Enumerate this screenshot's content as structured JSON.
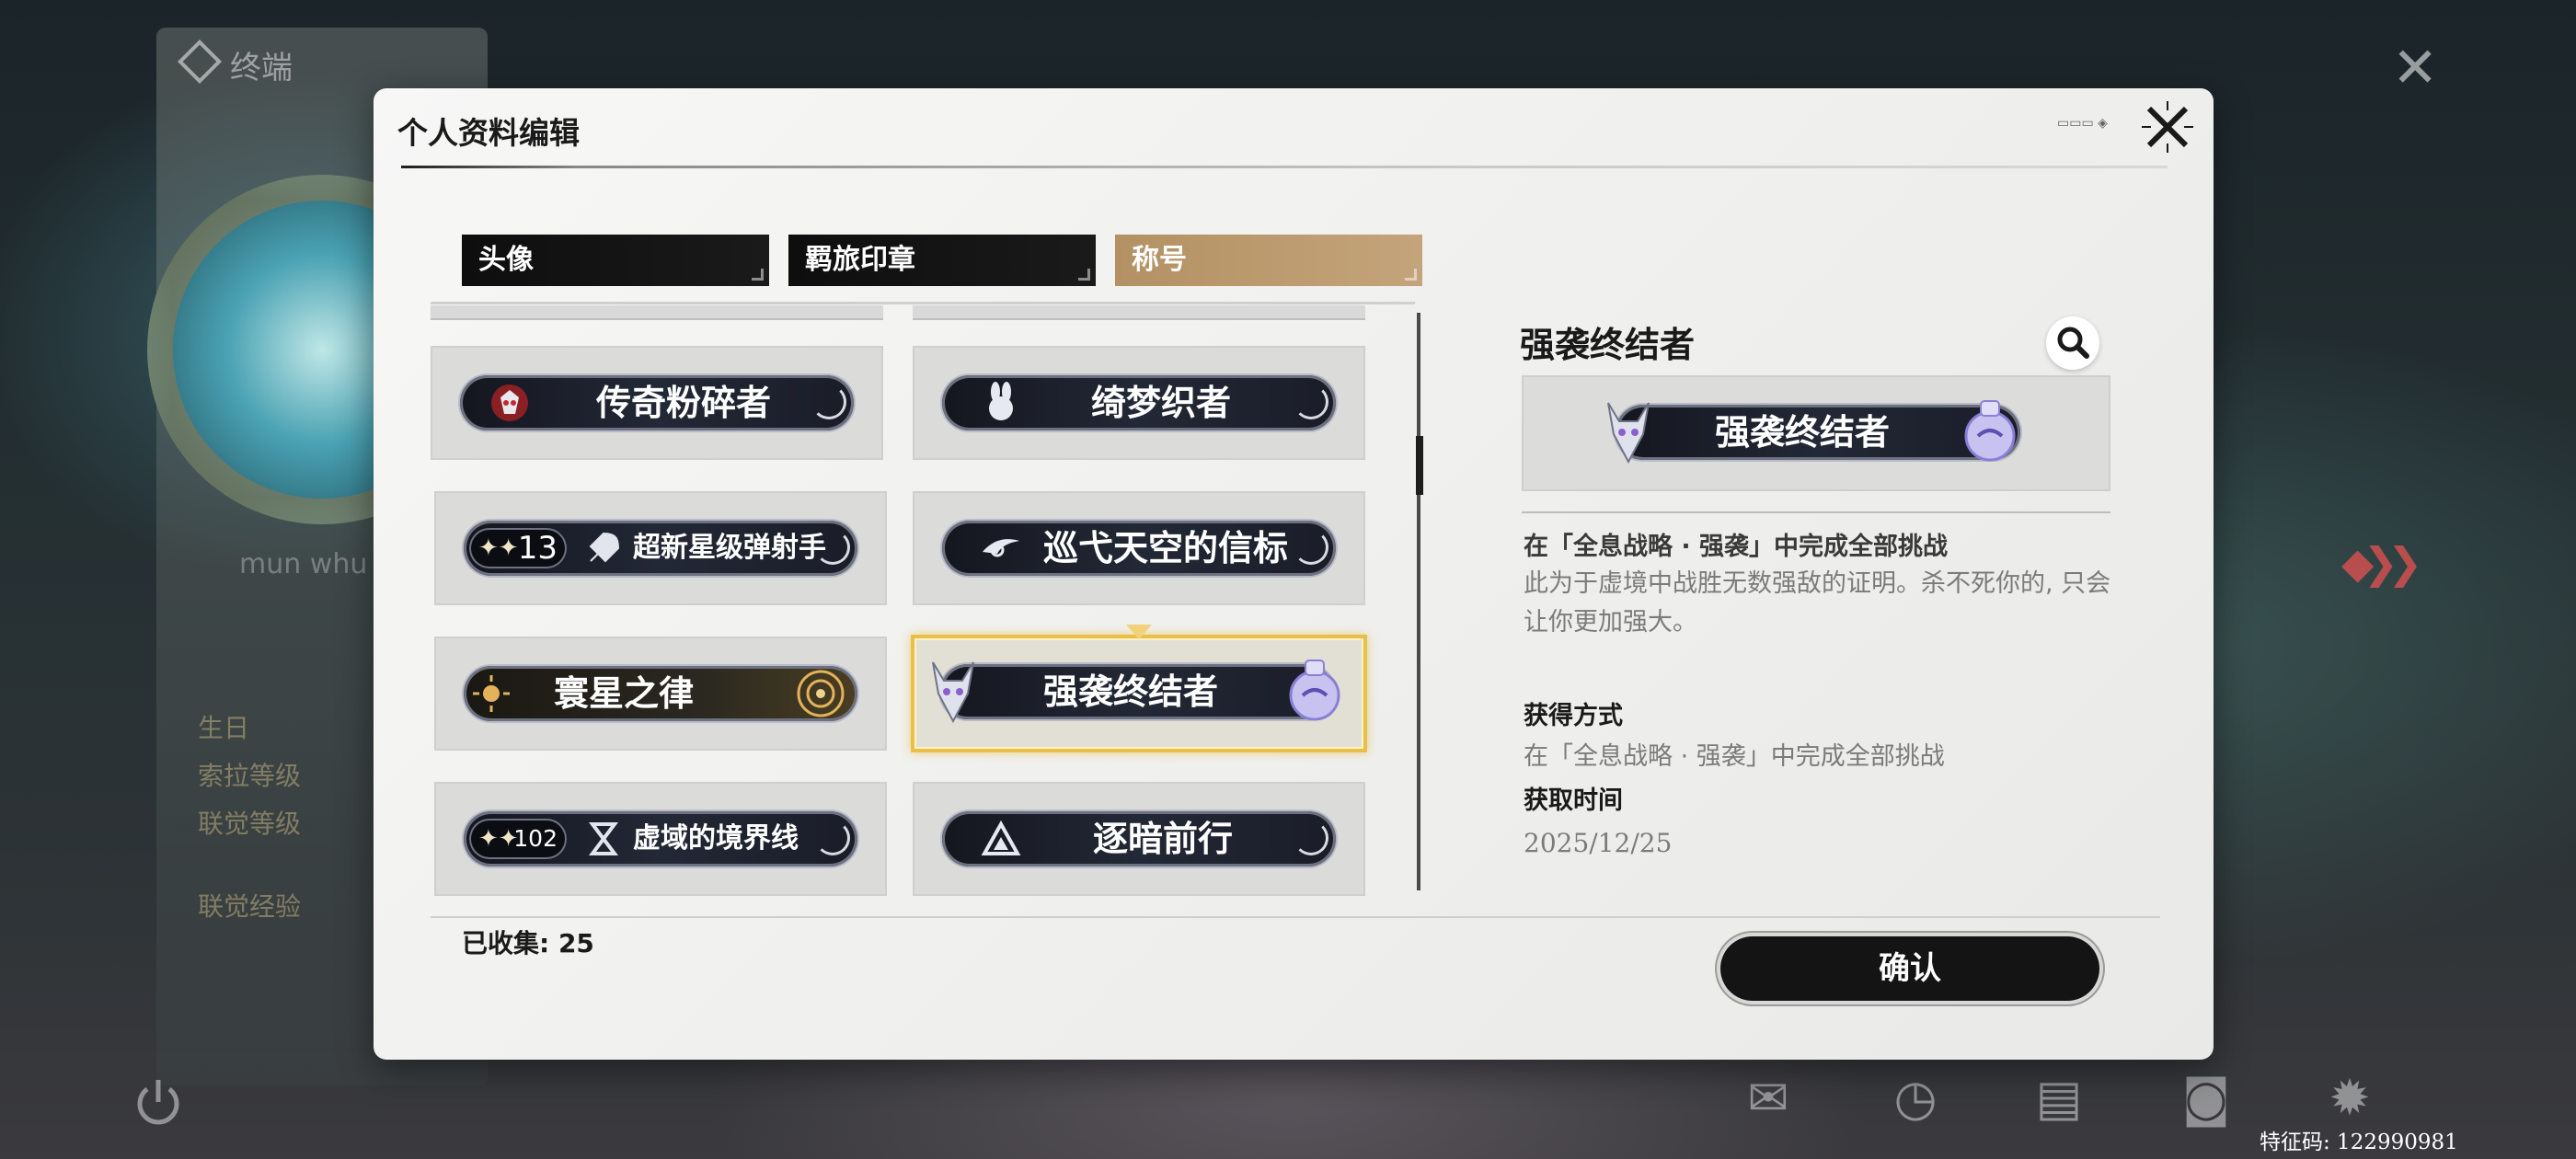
{
  "background": {
    "menu_title": "终端",
    "player_name": "mun whu",
    "side_items": [
      "生日",
      "索拉等级",
      "联觉等级",
      "联觉经验"
    ],
    "feature_code": "特征码: 122990981"
  },
  "dialog": {
    "title": "个人资料编辑",
    "tabs": [
      {
        "label": "头像",
        "active": false
      },
      {
        "label": "羁旅印章",
        "active": false
      },
      {
        "label": "称号",
        "active": true
      }
    ],
    "titles": [
      {
        "name": "传奇粉碎者",
        "icon": "mecha-face-icon"
      },
      {
        "name": "绮梦织者",
        "icon": "rabbit-icon"
      },
      {
        "name": "超新星级弹射手",
        "count": "13",
        "icon": "rocket-icon"
      },
      {
        "name": "巡弋天空的信标",
        "icon": "wing-emblem-icon"
      },
      {
        "name": "寰星之律",
        "icon": "sun-icon"
      },
      {
        "name": "强袭终结者",
        "icon": "horned-mask-icon",
        "selected": true
      },
      {
        "name": "虚域的境界线",
        "count": "102",
        "icon": "hourglass-icon"
      },
      {
        "name": "逐暗前行",
        "icon": "triangle-emblem-icon"
      }
    ],
    "collected_label": "已收集: 25",
    "detail": {
      "title": "强袭终结者",
      "badge_text": "强袭终结者",
      "condition": "在「全息战略 · 强袭」中完成全部挑战",
      "description": "此为于虚境中战胜无数强敌的证明。杀不死你的, 只会让你更加强大。",
      "obtain_label": "获得方式",
      "obtain_value": "在「全息战略 · 强袭」中完成全部挑战",
      "time_label": "获取时间",
      "time_value": "2025/12/25"
    },
    "confirm_label": "确认"
  },
  "colors": {
    "active_tab": "#b39164",
    "selected_border": "#e8c049",
    "badge_dark": "#14161f"
  }
}
